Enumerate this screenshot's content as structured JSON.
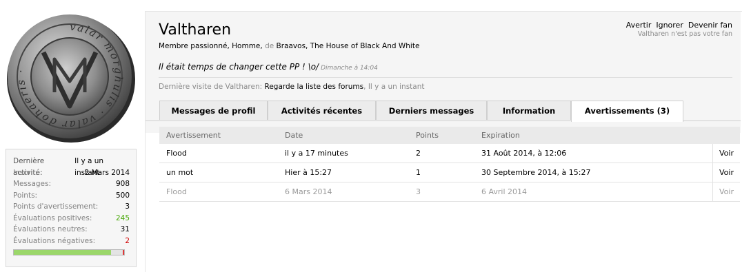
{
  "profile": {
    "name": "Valtharen",
    "subline": {
      "title": "Membre passionné",
      "gender": "Homme",
      "from_word": "de",
      "location": "Braavos",
      "house": "The House of Black And White"
    },
    "status_text": "Il était temps de changer cette PP ! \\o/",
    "status_time": "Dimanche à 14:04",
    "last_visit": {
      "label": "Dernière visite de Valtharen:",
      "activity": "Regarde la liste des forums",
      "time": "Il y a un instant"
    }
  },
  "actions": {
    "warn": "Avertir",
    "ignore": "Ignorer",
    "become_fan": "Devenir fan",
    "fan_note": "Valtharen n'est pas votre fan"
  },
  "avatar": {
    "coin_text": "valar morghulis · valar dohaeris ·",
    "monogram": "VM"
  },
  "stats": [
    {
      "label": "Dernière activité:",
      "value": "Il y a un instant"
    },
    {
      "label": "Inscrit:",
      "value": "2 Mars 2014"
    },
    {
      "label": "Messages:",
      "value": "908"
    },
    {
      "label": "Points:",
      "value": "500"
    },
    {
      "label": "Points d'avertissement:",
      "value": "3"
    },
    {
      "label": "Évaluations positives:",
      "value": "245"
    },
    {
      "label": "Évaluations neutres:",
      "value": "31"
    },
    {
      "label": "Évaluations négatives:",
      "value": "2"
    }
  ],
  "rating_ratio": {
    "positive": 245,
    "neutral": 31,
    "negative": 2
  },
  "tabs": [
    {
      "label": "Messages de profil"
    },
    {
      "label": "Activités récentes"
    },
    {
      "label": "Derniers messages"
    },
    {
      "label": "Information"
    },
    {
      "label": "Avertissements (3)",
      "active": true
    }
  ],
  "warnings": {
    "headers": [
      "Avertissement",
      "Date",
      "Points",
      "Expiration"
    ],
    "rows": [
      {
        "reason": "Flood",
        "date": "il y a 17 minutes",
        "points": "2",
        "expiration": "31 Août 2014, à 12:06",
        "action": "Voir",
        "expired": false
      },
      {
        "reason": "un mot",
        "date": "Hier à 15:27",
        "points": "1",
        "expiration": "30 Septembre 2014, à 15:27",
        "action": "Voir",
        "expired": false
      },
      {
        "reason": "Flood",
        "date": "6 Mars 2014",
        "points": "3",
        "expiration": "6 Avril 2014",
        "action": "Voir",
        "expired": true
      }
    ]
  },
  "colors": {
    "positive": "#48a808",
    "negative": "#d00000",
    "header_bg": "#f5f5f5"
  }
}
